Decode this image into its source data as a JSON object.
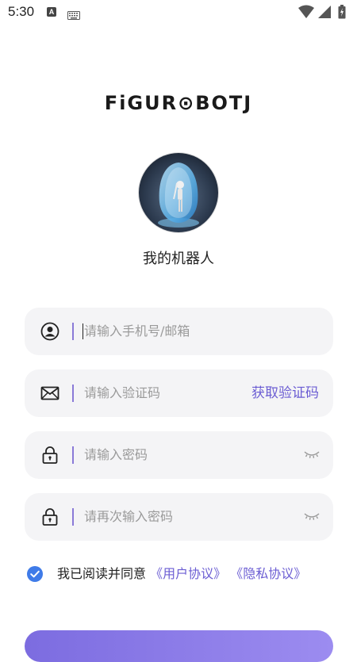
{
  "status_bar": {
    "time": "5:30",
    "a_icon_letter": "A"
  },
  "logo": {
    "text": "FiGUR⊙BOTJ"
  },
  "robot": {
    "name": "我的机器人"
  },
  "form": {
    "account_placeholder": "请输入手机号/邮箱",
    "code_placeholder": "请输入验证码",
    "get_code_label": "获取验证码",
    "password_placeholder": "请输入密码",
    "password_confirm_placeholder": "请再次输入密码"
  },
  "agreement": {
    "prefix": "我已阅读并同意",
    "user_agreement": "《用户协议》",
    "privacy_policy": "《隐私协议》",
    "checked": true
  },
  "colors": {
    "accent": "#6b5dd3",
    "field_bg": "#f4f4f6",
    "checkbox": "#3f7be8"
  }
}
